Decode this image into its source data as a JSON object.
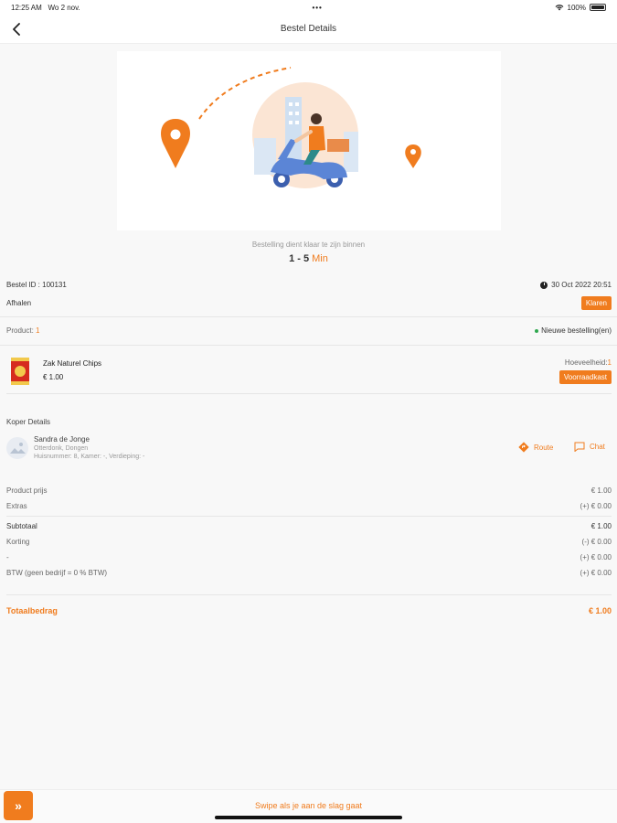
{
  "status_bar": {
    "time": "12:25 AM",
    "date": "Wo 2 nov.",
    "dots": "•••",
    "battery": "100%"
  },
  "header": {
    "title": "Bestel Details"
  },
  "eta": {
    "caption": "Bestelling dient klaar te zijn binnen",
    "range": "1 - 5",
    "unit": "Min"
  },
  "order": {
    "id_label": "Bestel ID : 100131",
    "datetime": "30 Oct 2022  20:51",
    "type": "Afhalen",
    "status_tag": "Klaren",
    "product_label": "Product:",
    "product_count": "1",
    "new_order_text": "Nieuwe bestelling(en)"
  },
  "product": {
    "name": "Zak Naturel Chips",
    "price": "€ 1.00",
    "quantity_label": "Hoeveelheid:",
    "quantity_value": "1",
    "preorder_tag": "Voorraadkast"
  },
  "buyer": {
    "section_title": "Koper Details",
    "name": "Sandra de Jonge",
    "address": "Otterdonk, Dongen",
    "house": "Huisnummer: 8, Kamer: -, Verdieping: -",
    "route_label": "Route",
    "chat_label": "Chat"
  },
  "summary": {
    "product_price_label": "Product prijs",
    "product_price": "€ 1.00",
    "extras_label": "Extras",
    "extras": "(+) € 0.00",
    "subtotal_label": "Subtotaal",
    "subtotal": "€ 1.00",
    "discount_label": "Korting",
    "discount": "(-) € 0.00",
    "dash_label": "-",
    "dash_value": "(+) € 0.00",
    "vat_label": "BTW (geen bedrijf = 0 % BTW)",
    "vat": "(+) € 0.00",
    "total_label": "Totaalbedrag",
    "total": "€ 1.00"
  },
  "swipe": {
    "handle_glyph": "»",
    "text": "Swipe als je aan de slag gaat"
  },
  "colors": {
    "accent": "#f07c1e",
    "green": "#2fa84f"
  }
}
